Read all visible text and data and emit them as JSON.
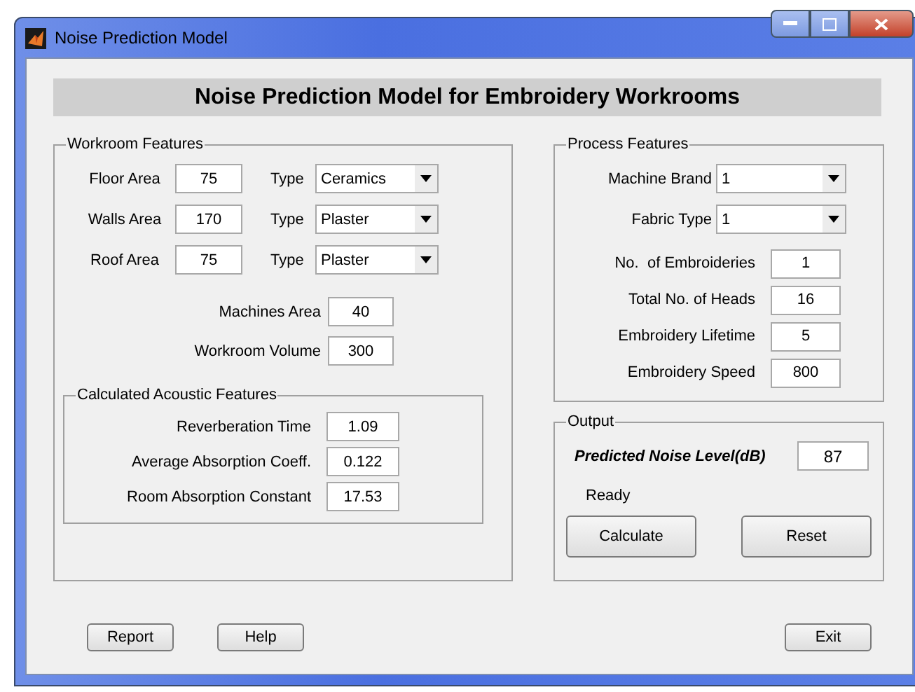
{
  "window": {
    "title": "Noise Prediction Model"
  },
  "header": "Noise Prediction Model for Embroidery Workrooms",
  "workroom_features": {
    "title": "Workroom Features",
    "surfaces": [
      {
        "label": "Floor Area",
        "value": "75",
        "type_label": "Type",
        "type_value": "Ceramics"
      },
      {
        "label": "Walls Area",
        "value": "170",
        "type_label": "Type",
        "type_value": "Plaster"
      },
      {
        "label": "Roof Area",
        "value": "75",
        "type_label": "Type",
        "type_value": "Plaster"
      }
    ],
    "fields": [
      {
        "label": "Machines Area",
        "value": "40"
      },
      {
        "label": "Workroom Volume",
        "value": "300"
      }
    ],
    "calculated": {
      "title": "Calculated Acoustic Features",
      "fields": [
        {
          "label": "Reverberation Time",
          "value": "1.09"
        },
        {
          "label": "Average Absorption Coeff.",
          "value": "0.122"
        },
        {
          "label": "Room Absorption Constant",
          "value": "17.53"
        }
      ]
    }
  },
  "process_features": {
    "title": "Process Features",
    "dropdowns": [
      {
        "label": "Machine Brand",
        "value": "1"
      },
      {
        "label": "Fabric Type",
        "value": "1"
      }
    ],
    "fields": [
      {
        "label": "No.  of Embroideries",
        "value": "1"
      },
      {
        "label": "Total No. of Heads",
        "value": "16"
      },
      {
        "label": "Embroidery Lifetime",
        "value": "5"
      },
      {
        "label": "Embroidery Speed",
        "value": "800"
      }
    ]
  },
  "output": {
    "title": "Output",
    "result_label": "Predicted Noise Level(dB)",
    "result_value": "87",
    "status": "Ready",
    "buttons": [
      "Calculate",
      "Reset"
    ]
  },
  "buttons": [
    "Report",
    "Help",
    "Exit"
  ]
}
